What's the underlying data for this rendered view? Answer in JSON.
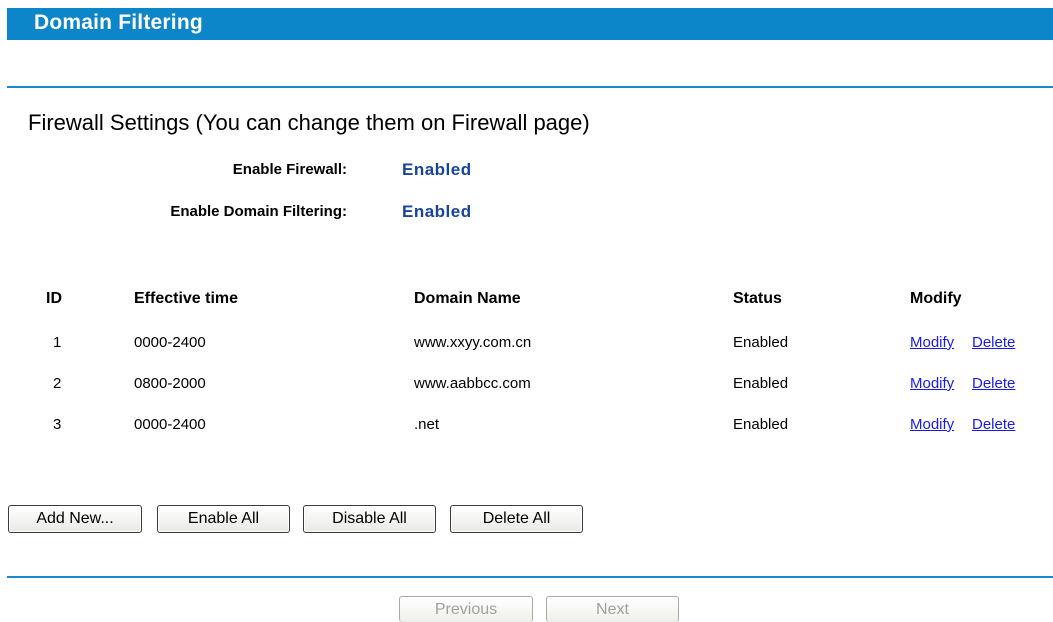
{
  "header": {
    "title": "Domain Filtering"
  },
  "firewall": {
    "section_title": "Firewall Settings (You can change them on Firewall page)",
    "enable_firewall_label": "Enable Firewall:",
    "enable_firewall_value": "Enabled",
    "enable_domain_filtering_label": "Enable Domain Filtering:",
    "enable_domain_filtering_value": "Enabled"
  },
  "table": {
    "headers": {
      "id": "ID",
      "effective_time": "Effective time",
      "domain_name": "Domain Name",
      "status": "Status",
      "modify": "Modify"
    },
    "rows": [
      {
        "id": "1",
        "effective_time": "0000-2400",
        "domain_name": "www.xxyy.com.cn",
        "status": "Enabled",
        "modify_link": "Modify",
        "delete_link": "Delete"
      },
      {
        "id": "2",
        "effective_time": "0800-2000",
        "domain_name": "www.aabbcc.com",
        "status": "Enabled",
        "modify_link": "Modify",
        "delete_link": "Delete"
      },
      {
        "id": "3",
        "effective_time": "0000-2400",
        "domain_name": ".net",
        "status": "Enabled",
        "modify_link": "Modify",
        "delete_link": "Delete"
      }
    ]
  },
  "actions": {
    "add_new": "Add New...",
    "enable_all": "Enable All",
    "disable_all": "Disable All",
    "delete_all": "Delete All"
  },
  "pager": {
    "previous": "Previous",
    "next": "Next"
  },
  "colors": {
    "title_bar": "#0c86c8",
    "rule": "#1c88c8",
    "value_text": "#17459c",
    "link": "#1a1ae6"
  }
}
